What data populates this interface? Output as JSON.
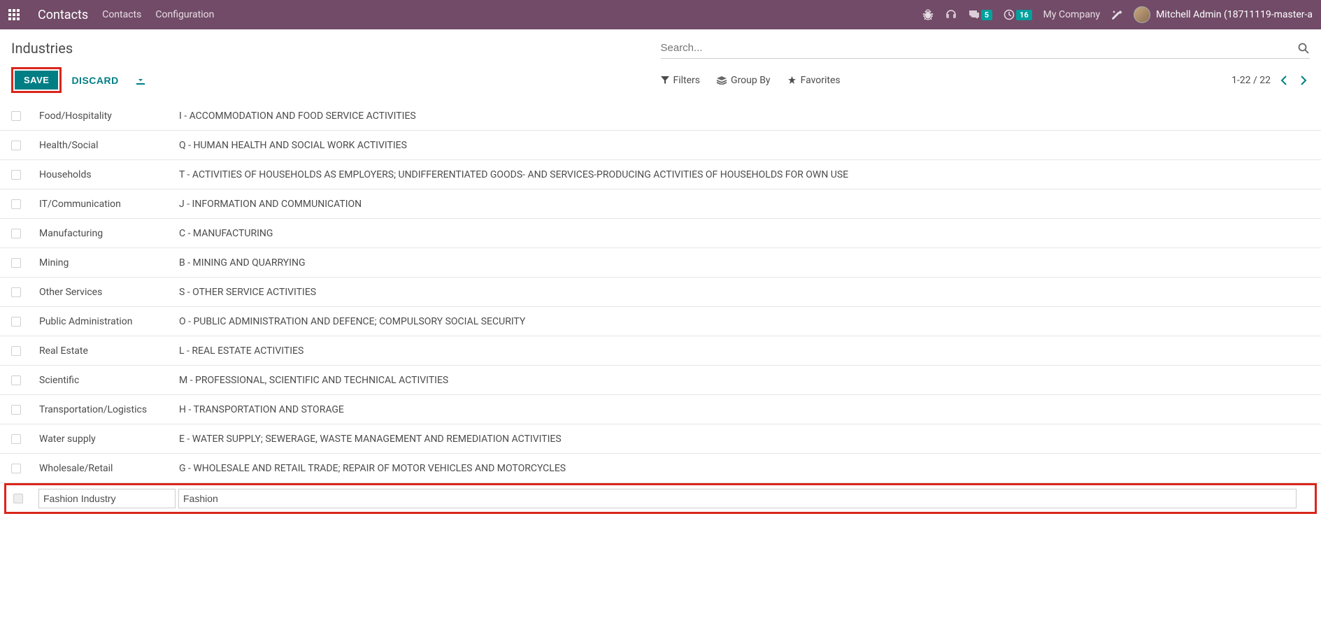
{
  "navbar": {
    "brand": "Contacts",
    "links": [
      "Contacts",
      "Configuration"
    ],
    "messages_badge": "5",
    "clock_badge": "16",
    "company": "My Company",
    "user": "Mitchell Admin (18711119-master-a"
  },
  "control_panel": {
    "title": "Industries",
    "search_placeholder": "Search...",
    "save_label": "SAVE",
    "discard_label": "DISCARD",
    "filters_label": "Filters",
    "groupby_label": "Group By",
    "favorites_label": "Favorites",
    "pager": "1-22 / 22"
  },
  "rows": [
    {
      "name": "Food/Hospitality",
      "desc": "I - ACCOMMODATION AND FOOD SERVICE ACTIVITIES"
    },
    {
      "name": "Health/Social",
      "desc": "Q - HUMAN HEALTH AND SOCIAL WORK ACTIVITIES"
    },
    {
      "name": "Households",
      "desc": "T - ACTIVITIES OF HOUSEHOLDS AS EMPLOYERS; UNDIFFERENTIATED GOODS- AND SERVICES-PRODUCING ACTIVITIES OF HOUSEHOLDS FOR OWN USE"
    },
    {
      "name": "IT/Communication",
      "desc": "J - INFORMATION AND COMMUNICATION"
    },
    {
      "name": "Manufacturing",
      "desc": "C - MANUFACTURING"
    },
    {
      "name": "Mining",
      "desc": "B - MINING AND QUARRYING"
    },
    {
      "name": "Other Services",
      "desc": "S - OTHER SERVICE ACTIVITIES"
    },
    {
      "name": "Public Administration",
      "desc": "O - PUBLIC ADMINISTRATION AND DEFENCE; COMPULSORY SOCIAL SECURITY"
    },
    {
      "name": "Real Estate",
      "desc": "L - REAL ESTATE ACTIVITIES"
    },
    {
      "name": "Scientific",
      "desc": "M - PROFESSIONAL, SCIENTIFIC AND TECHNICAL ACTIVITIES"
    },
    {
      "name": "Transportation/Logistics",
      "desc": "H - TRANSPORTATION AND STORAGE"
    },
    {
      "name": "Water supply",
      "desc": "E - WATER SUPPLY; SEWERAGE, WASTE MANAGEMENT AND REMEDIATION ACTIVITIES"
    },
    {
      "name": "Wholesale/Retail",
      "desc": "G - WHOLESALE AND RETAIL TRADE; REPAIR OF MOTOR VEHICLES AND MOTORCYCLES"
    }
  ],
  "edit_row": {
    "name": "Fashion Industry",
    "desc": "Fashion"
  }
}
